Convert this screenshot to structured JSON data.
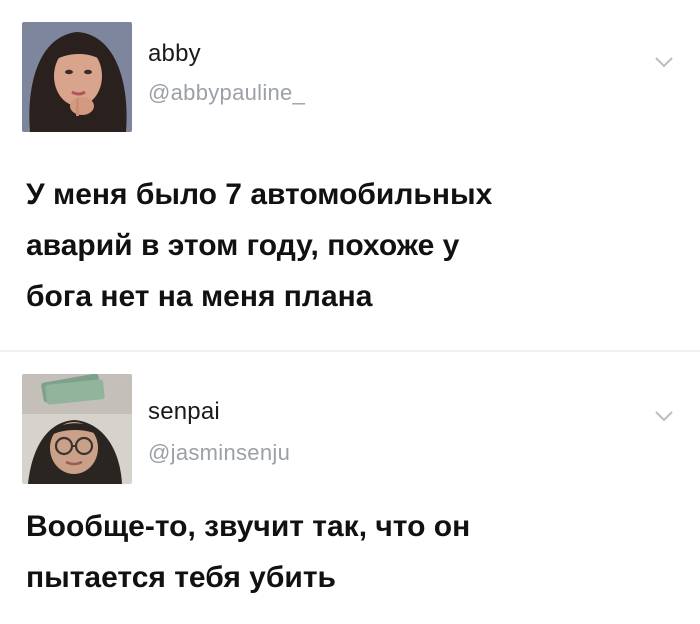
{
  "tweets": [
    {
      "display_name": "abby",
      "handle": "@abbypauline_",
      "text": "У меня было 7 автомобильных\nаварий в этом году, похоже у\nбога нет на меня плана"
    },
    {
      "display_name": "senpai",
      "handle": "@jasminsenju",
      "text": "Вообще-то, звучит так, что он\nпытается тебя убить"
    }
  ],
  "icons": {
    "menu": "chevron-down-icon"
  },
  "colors": {
    "background": "#ffffff",
    "handle": "#9ba1a7",
    "text": "#111111",
    "chevron": "#b8bec4"
  }
}
